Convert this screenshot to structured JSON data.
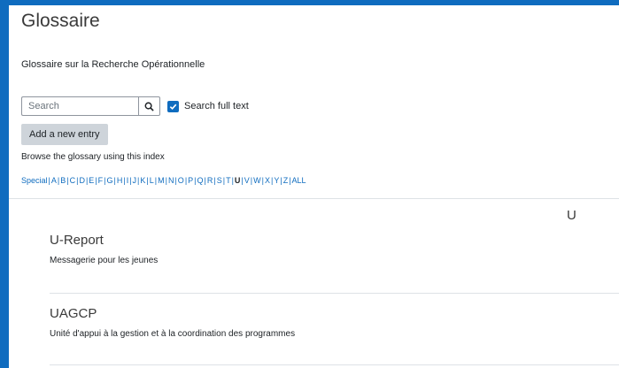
{
  "page": {
    "title": "Glossaire",
    "subtitle": "Glossaire sur la Recherche Opérationnelle"
  },
  "search": {
    "placeholder": "Search",
    "checkbox_label": "Search full text",
    "checkbox_checked": true
  },
  "actions": {
    "add_entry_label": "Add a new entry"
  },
  "browse": {
    "label": "Browse the glossary using this index",
    "index": [
      "Special",
      "A",
      "B",
      "C",
      "D",
      "E",
      "F",
      "G",
      "H",
      "I",
      "J",
      "K",
      "L",
      "M",
      "N",
      "O",
      "P",
      "Q",
      "R",
      "S",
      "T",
      "U",
      "V",
      "W",
      "X",
      "Y",
      "Z",
      "ALL"
    ],
    "current": "U"
  },
  "section": {
    "letter": "U"
  },
  "entries": [
    {
      "concept": "U-Report",
      "definition": "Messagerie pour les jeunes"
    },
    {
      "concept": "UAGCP",
      "definition": "Unité d'appui à la gestion et à la coordination des programmes"
    }
  ],
  "colors": {
    "accent": "#0f6cbf",
    "button_bg": "#ced4da",
    "divider": "#dee2e6"
  }
}
